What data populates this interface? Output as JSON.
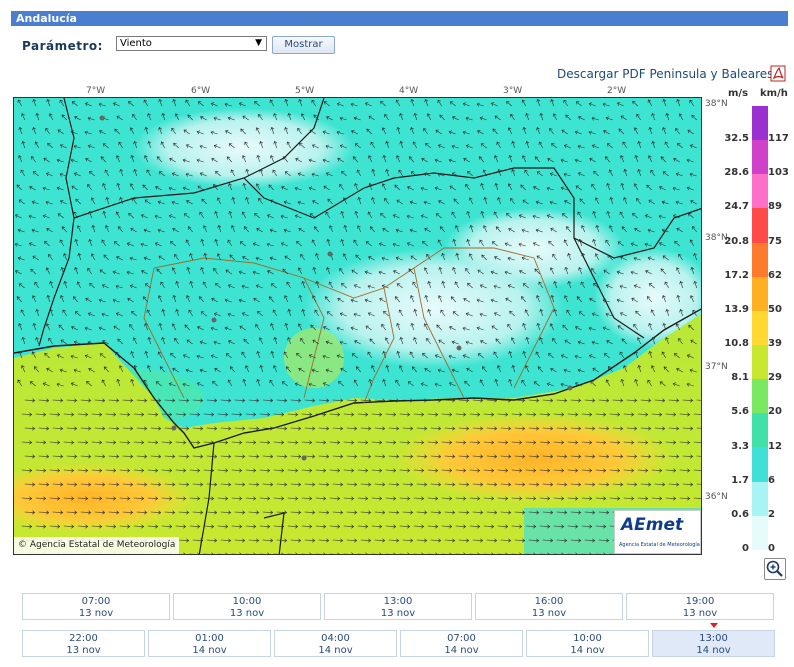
{
  "header": {
    "title": "Andalucía"
  },
  "param": {
    "label": "Parámetro:",
    "selected": "Viento",
    "button": "Mostrar"
  },
  "pdf": {
    "link": "Descargar PDF Peninsula y Baleares"
  },
  "map": {
    "lon_labels": [
      "7°W",
      "6°W",
      "5°W",
      "4°W",
      "3°W",
      "2°W"
    ],
    "lat_labels": [
      "38°N",
      "38°N",
      "37°N",
      "36°N"
    ],
    "copyright": "© Agencia Estatal de Meteorología",
    "logo_text": "AEmet",
    "logo_sub": "Agencia Estatal de Meteorología"
  },
  "legend": {
    "unit_ms": "m/s",
    "unit_kmh": "km/h",
    "steps": [
      {
        "ms": "32.5",
        "kmh": "117",
        "color": "#9b30d0"
      },
      {
        "ms": "28.6",
        "kmh": "103",
        "color": "#d040c8"
      },
      {
        "ms": "24.7",
        "kmh": "89",
        "color": "#ff6ec8"
      },
      {
        "ms": "20.8",
        "kmh": "75",
        "color": "#ff4a4a"
      },
      {
        "ms": "17.2",
        "kmh": "62",
        "color": "#ff7a2a"
      },
      {
        "ms": "13.9",
        "kmh": "50",
        "color": "#ffb020"
      },
      {
        "ms": "10.8",
        "kmh": "39",
        "color": "#ffd830"
      },
      {
        "ms": "8.1",
        "kmh": "29",
        "color": "#c8e830"
      },
      {
        "ms": "5.6",
        "kmh": "20",
        "color": "#7ae860"
      },
      {
        "ms": "3.3",
        "kmh": "12",
        "color": "#40e0a8"
      },
      {
        "ms": "1.7",
        "kmh": "6",
        "color": "#40e0d8"
      },
      {
        "ms": "0.6",
        "kmh": "2",
        "color": "#a8f4f4"
      },
      {
        "ms": "0",
        "kmh": "0",
        "color": "#e6fbfb"
      }
    ]
  },
  "times": [
    {
      "time": "07:00",
      "date": "13 nov"
    },
    {
      "time": "10:00",
      "date": "13 nov"
    },
    {
      "time": "13:00",
      "date": "13 nov"
    },
    {
      "time": "16:00",
      "date": "13 nov"
    },
    {
      "time": "19:00",
      "date": "13 nov"
    },
    {
      "time": "22:00",
      "date": "13 nov"
    },
    {
      "time": "01:00",
      "date": "14 nov"
    },
    {
      "time": "04:00",
      "date": "14 nov"
    },
    {
      "time": "07:00",
      "date": "14 nov"
    },
    {
      "time": "10:00",
      "date": "14 nov"
    },
    {
      "time": "13:00",
      "date": "14 nov",
      "active": true
    }
  ]
}
